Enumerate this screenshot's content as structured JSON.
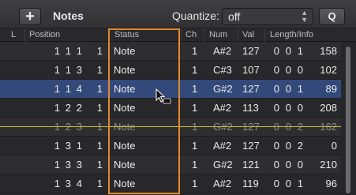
{
  "toolbar": {
    "add_label": "+",
    "title": "Notes",
    "quantize_label": "Quantize:",
    "quantize_value": "off",
    "q_label": "Q"
  },
  "columns": [
    "L",
    "Position",
    "Status",
    "Ch",
    "Num",
    "Val",
    "Length/Info"
  ],
  "rows": [
    {
      "position": [
        "1",
        "1",
        "1",
        "1"
      ],
      "status": "Note",
      "ch": "1",
      "num": "A#2",
      "val": "127",
      "length": [
        "0",
        "0",
        "1",
        "158"
      ],
      "state": "normal"
    },
    {
      "position": [
        "1",
        "1",
        "3",
        "1"
      ],
      "status": "Note",
      "ch": "1",
      "num": "C#3",
      "val": "107",
      "length": [
        "0",
        "0",
        "0",
        "102"
      ],
      "state": "normal"
    },
    {
      "position": [
        "1",
        "1",
        "4",
        "1"
      ],
      "status": "Note",
      "ch": "1",
      "num": "G#2",
      "val": "127",
      "length": [
        "0",
        "0",
        "1",
        "89"
      ],
      "state": "selected"
    },
    {
      "position": [
        "1",
        "2",
        "2",
        "1"
      ],
      "status": "Note",
      "ch": "1",
      "num": "A#2",
      "val": "113",
      "length": [
        "0",
        "0",
        "0",
        "208"
      ],
      "state": "normal"
    },
    {
      "position": [
        "1",
        "2",
        "3",
        "1"
      ],
      "status": "Note",
      "ch": "1",
      "num": "G#2",
      "val": "127",
      "length": [
        "0",
        "0",
        "2",
        "162"
      ],
      "state": "dim"
    },
    {
      "position": [
        "1",
        "3",
        "1",
        "1"
      ],
      "status": "Note",
      "ch": "1",
      "num": "A#2",
      "val": "127",
      "length": [
        "0",
        "0",
        "2",
        "0"
      ],
      "state": "normal"
    },
    {
      "position": [
        "1",
        "3",
        "3",
        "1"
      ],
      "status": "Note",
      "ch": "1",
      "num": "G#2",
      "val": "121",
      "length": [
        "0",
        "0",
        "0",
        "210"
      ],
      "state": "normal"
    },
    {
      "position": [
        "1",
        "3",
        "4",
        "1"
      ],
      "status": "Note",
      "ch": "1",
      "num": "A#2",
      "val": "119",
      "length": [
        "0",
        "0",
        "1",
        "96"
      ],
      "state": "normal"
    }
  ],
  "colors": {
    "selection": "#33497a",
    "status_highlight": "#e08a2a",
    "playhead": "#d7c03a"
  },
  "icons": [
    "plus-icon",
    "chevron-updown-icon",
    "pointer-cursor-icon"
  ]
}
